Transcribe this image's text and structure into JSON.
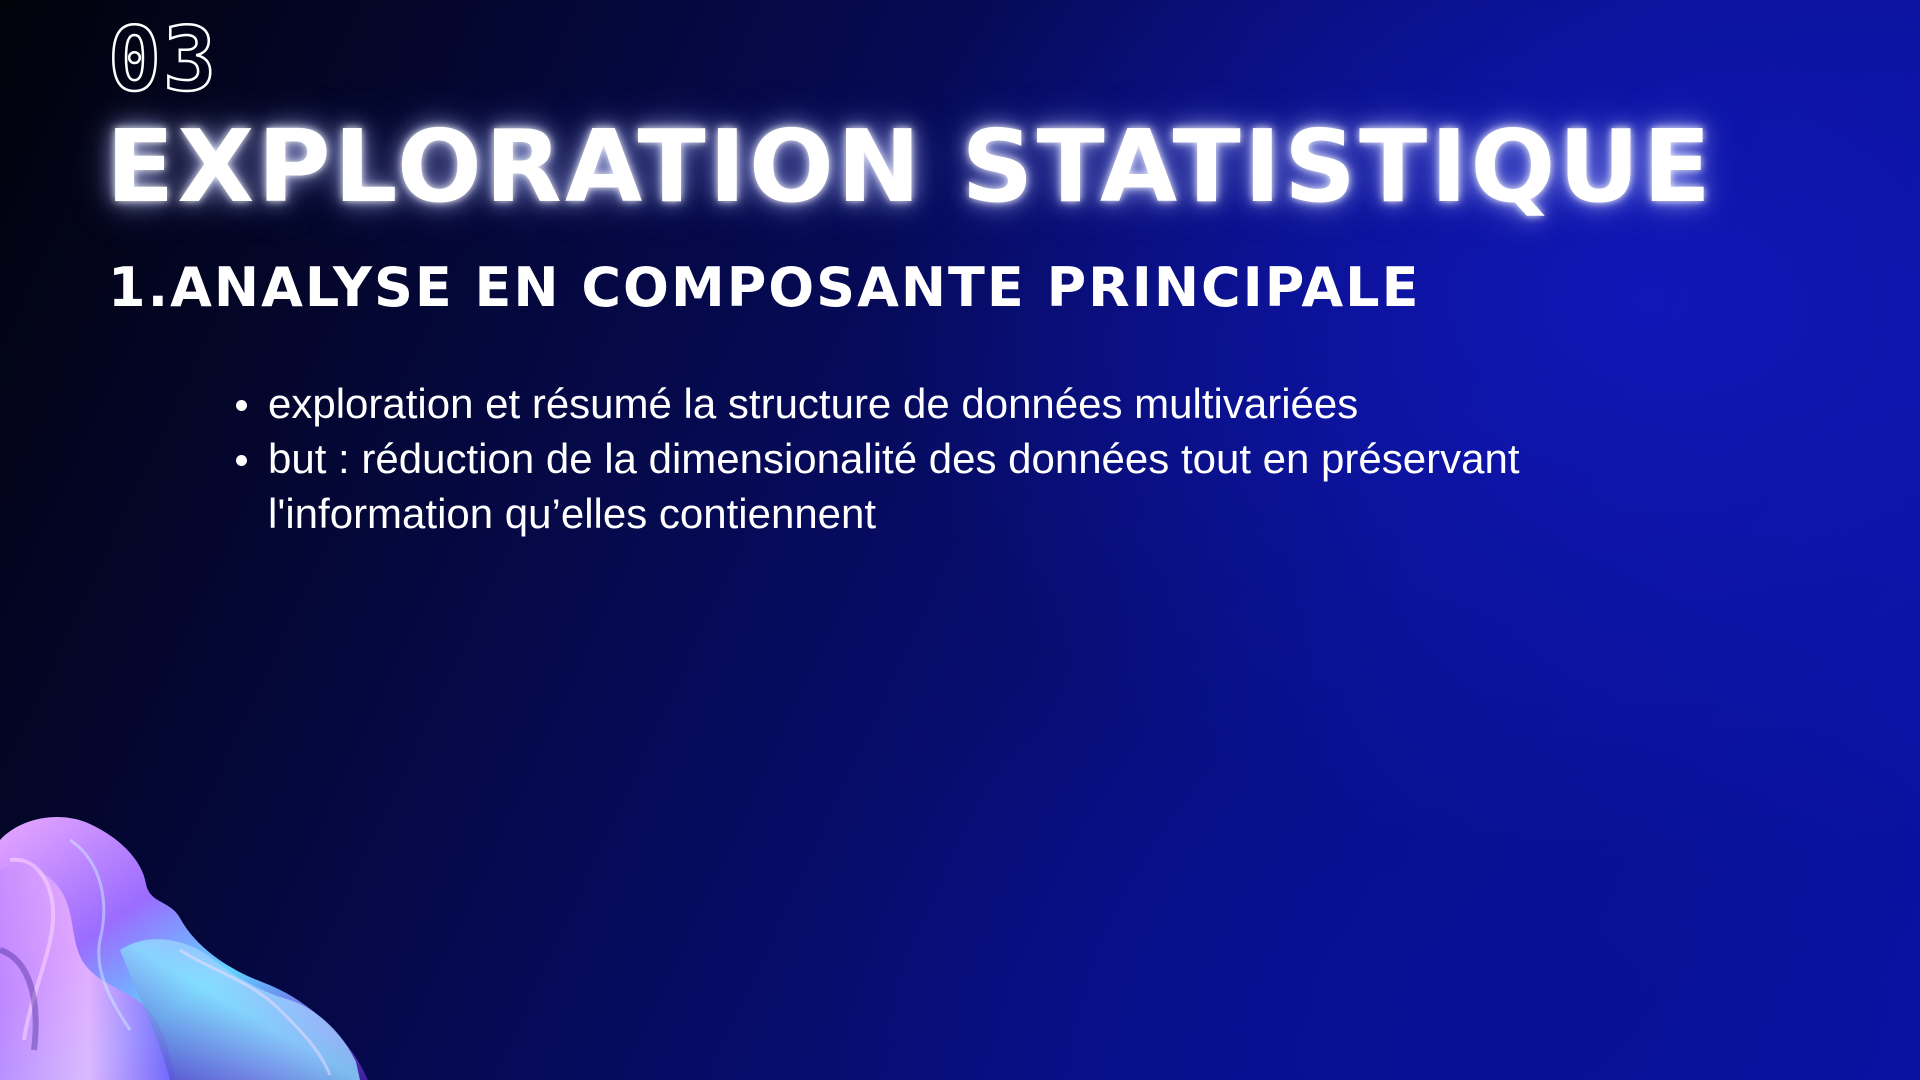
{
  "slide": {
    "number": "03",
    "title": "EXPLORATION STATISTIQUE",
    "subtitle": "1.ANALYSE EN COMPOSANTE PRINCIPALE",
    "bullets": [
      "exploration et résumé la structure de données multivariées",
      "but : réduction de la dimensionalité des données tout en préservant l'information qu’elles contiennent"
    ]
  },
  "colors": {
    "background_dark": "#02020a",
    "background_blue": "#0a14a8",
    "text": "#ffffff",
    "decor_purple": "#9b6cff",
    "decor_pink": "#e8a8ff",
    "decor_cyan": "#5fd4ff"
  },
  "decor": {
    "icon": "iridescent-fabric-sculpture"
  }
}
